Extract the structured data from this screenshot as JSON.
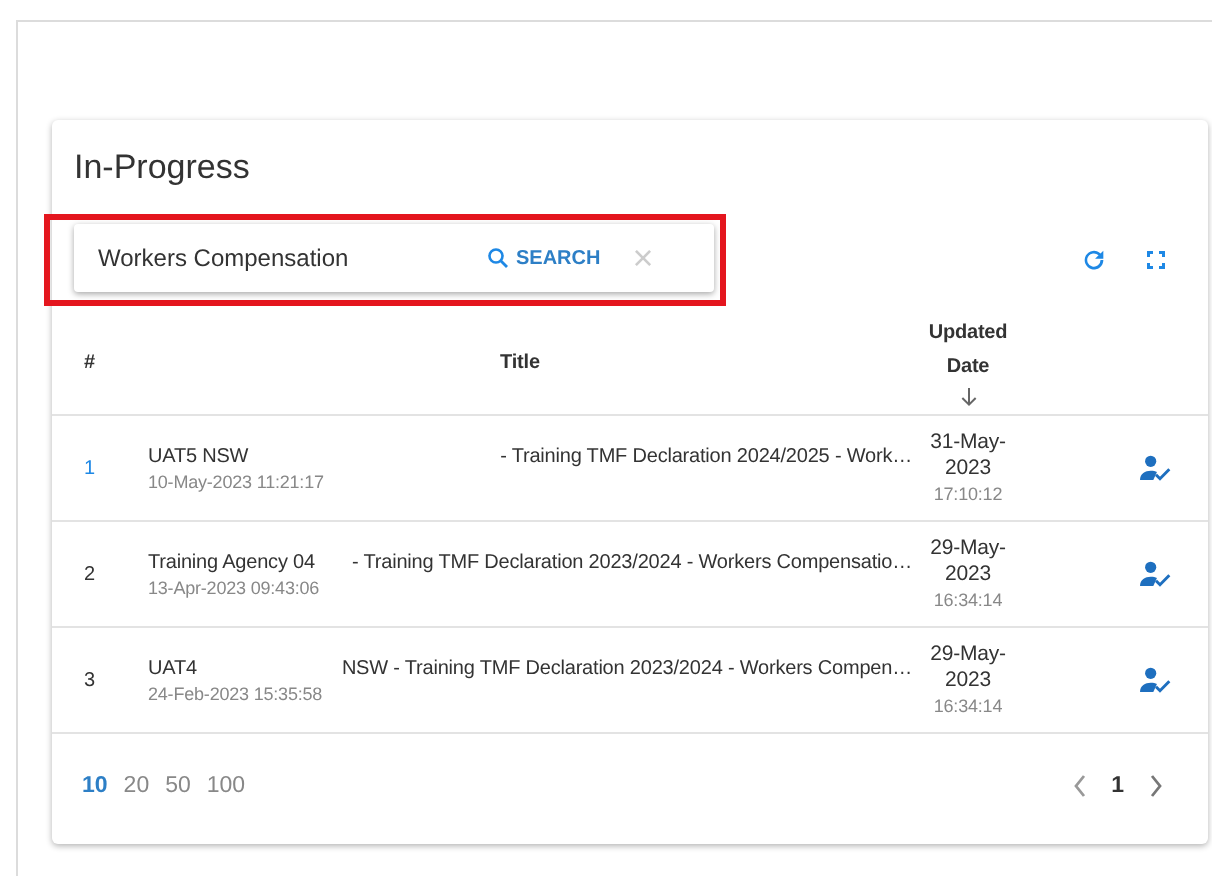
{
  "card": {
    "title": "In-Progress"
  },
  "search": {
    "value": "Workers Compensation",
    "button": "SEARCH",
    "clear": "×",
    "highlighted": true
  },
  "table": {
    "columns": [
      {
        "label": "#"
      },
      {
        "label": "Title"
      },
      {
        "label": "Updated Date",
        "sorted": true
      }
    ],
    "rows": [
      {
        "number": "1",
        "agency": "UAT5 NSW",
        "title": "- Training TMF Declaration 2024/2025 - Work…",
        "created": "10-May-2023 11:21:17",
        "updated_date": "31-May-2023",
        "updated_time": "17:10:12"
      },
      {
        "number": "2",
        "agency": "Training Agency 04",
        "title": "- Training TMF Declaration 2023/2024 - Workers Compensatio…",
        "created": "13-Apr-2023 09:43:06",
        "updated_date": "29-May-2023",
        "updated_time": "16:34:14"
      },
      {
        "number": "3",
        "agency": "UAT4",
        "title": "NSW - Training TMF Declaration 2023/2024 - Workers Compen…",
        "created": "24-Feb-2023 15:35:58",
        "updated_date": "29-May-2023",
        "updated_time": "16:34:14"
      }
    ]
  },
  "page_sizes": [
    {
      "label": "10",
      "selected": true
    },
    {
      "label": "20",
      "selected": false
    },
    {
      "label": "50",
      "selected": false
    },
    {
      "label": "100",
      "selected": false
    }
  ],
  "pagination": {
    "current": "1"
  }
}
